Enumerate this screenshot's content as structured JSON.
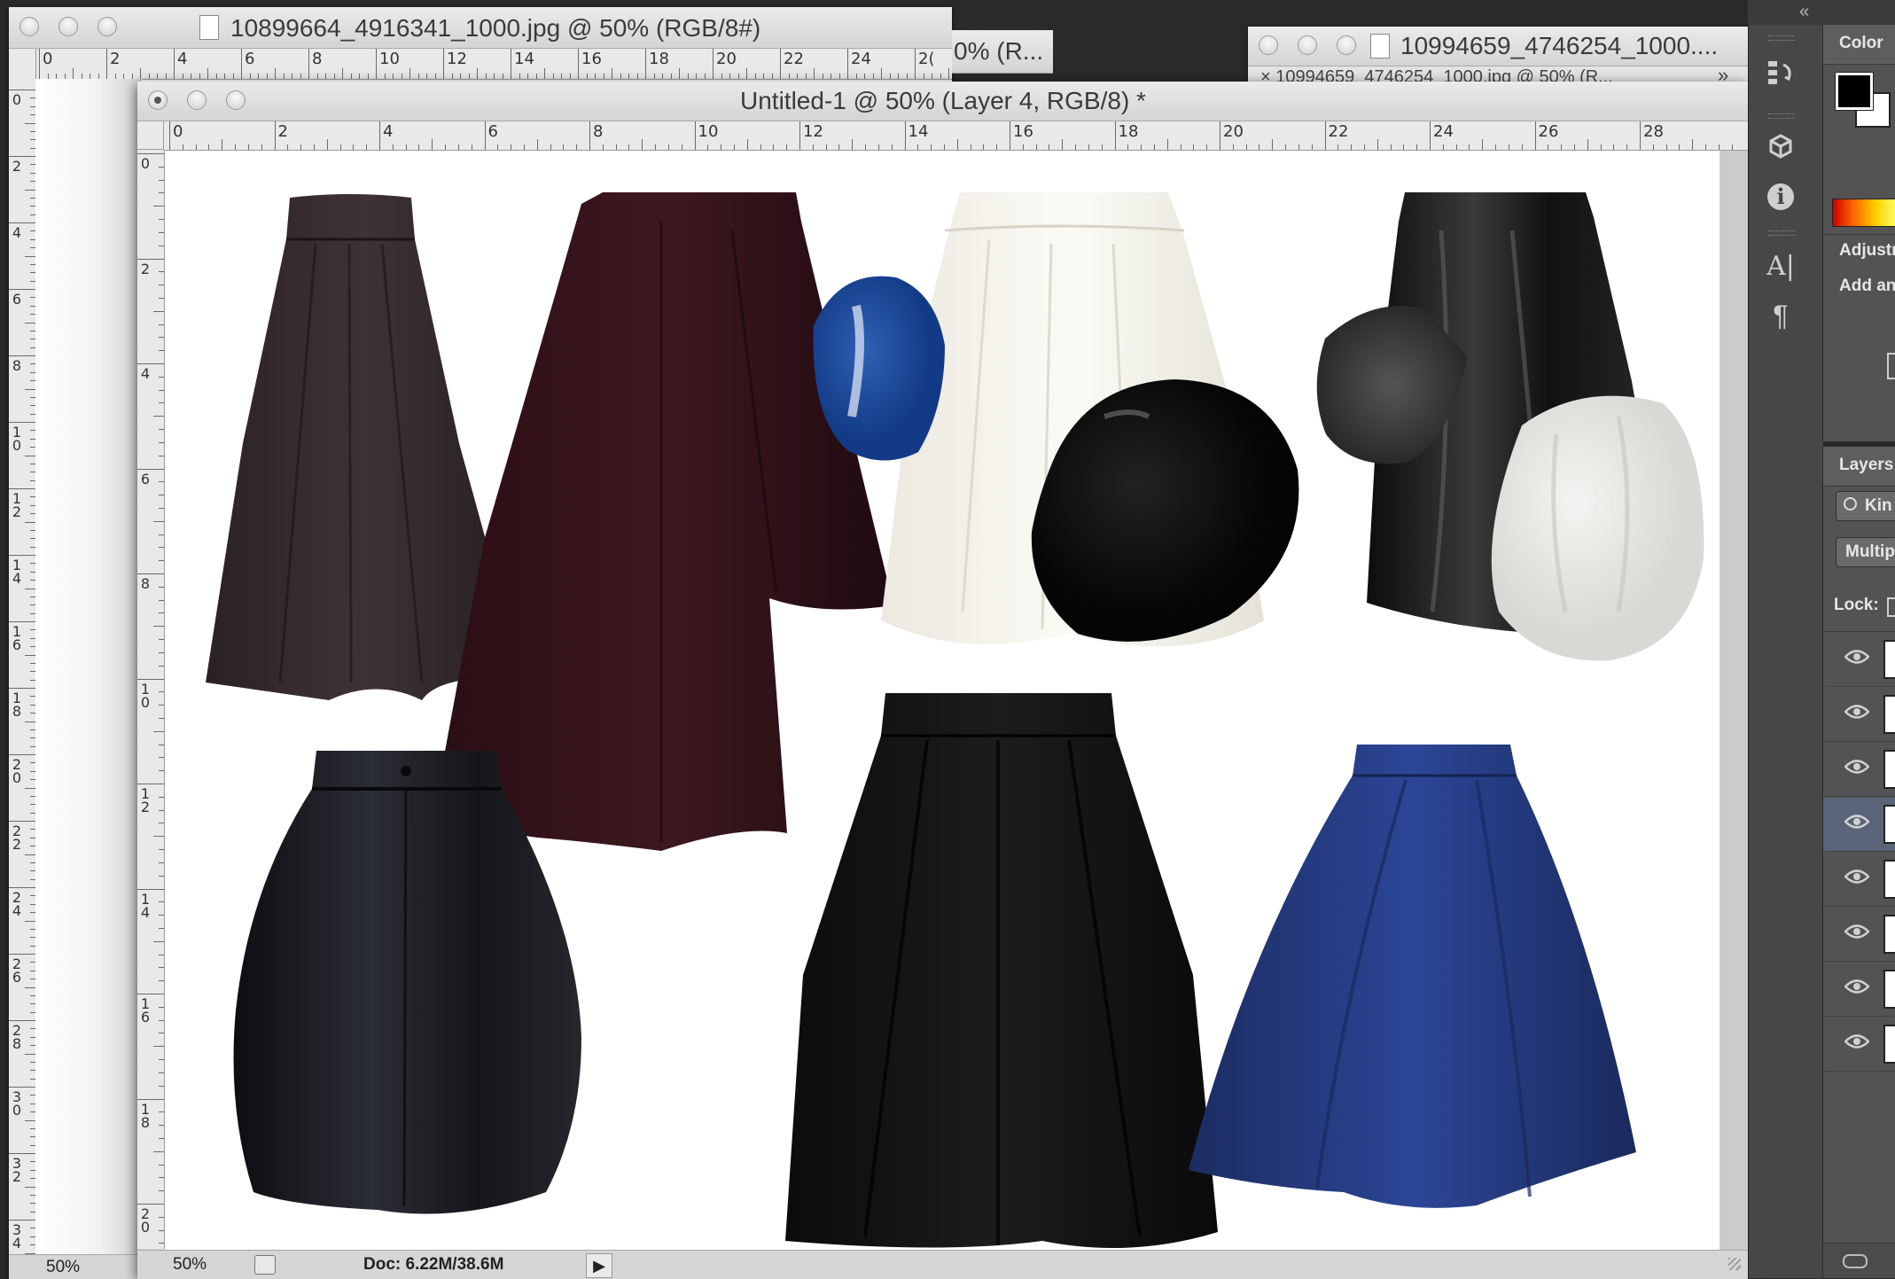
{
  "windows": {
    "back_left": {
      "title": "10899664_4916341_1000.jpg @ 50% (RGB/8#)",
      "zoom": "50%"
    },
    "back_middle": {
      "title": "0% (R..."
    },
    "back_right": {
      "title": "10994659_4746254_1000....",
      "subtitle": "× 10994659_4746254_1000.jpg @ 50% (R...",
      "collapse": "»"
    },
    "main": {
      "title": "Untitled-1 @ 50% (Layer 4, RGB/8) *",
      "zoom": "50%",
      "doc_info": "Doc: 6.22M/38.6M",
      "play": "▶"
    }
  },
  "rulers": {
    "back_h": [
      "0",
      "2",
      "4",
      "6",
      "8",
      "10",
      "12",
      "14",
      "16",
      "18",
      "20",
      "22",
      "24",
      "2("
    ],
    "main_h": [
      "0",
      "2",
      "4",
      "6",
      "8",
      "10",
      "12",
      "14",
      "16",
      "18",
      "20",
      "22",
      "24",
      "26",
      "28"
    ],
    "back_v": [
      "0",
      "2",
      "4",
      "6",
      "8",
      "10",
      "12",
      "14",
      "16",
      "18",
      "20",
      "22",
      "24",
      "26",
      "28",
      "30",
      "32",
      "34"
    ],
    "main_v": [
      "0",
      "2",
      "4",
      "6",
      "8",
      "10",
      "12",
      "14",
      "16",
      "18",
      "20"
    ]
  },
  "panels": {
    "collapse_arrows": "«",
    "color": {
      "title": "Color"
    },
    "adjustments": {
      "title": "Adjustm",
      "hint": "Add an"
    },
    "layers": {
      "title": "Layers",
      "filter": "Kin",
      "blend": "Multip",
      "lock": "Lock:"
    },
    "layer_count": 8
  },
  "tools": [
    "history-icon",
    "3d-icon",
    "info-icon",
    "character-icon",
    "paragraph-icon"
  ],
  "tool_glyphs": {
    "history": "↺",
    "info": "i",
    "character": "A|",
    "paragraph": "¶"
  },
  "colors": {
    "canvas": "#ffffff",
    "chrome": "#d6d6d6",
    "panel": "#535353",
    "tools": "#474747"
  },
  "canvas_items": [
    "brown-a-line-skirt",
    "burgundy-asymmetric-skirt",
    "white-pleated-skirt",
    "black-vinyl-skirt",
    "black-leather-skirt",
    "black-pleated-midi-skirt",
    "blue-flared-skirt",
    "blue-glossy-swatch",
    "black-glossy-swatch",
    "black-satin-swatch",
    "white-satin-swatch"
  ]
}
